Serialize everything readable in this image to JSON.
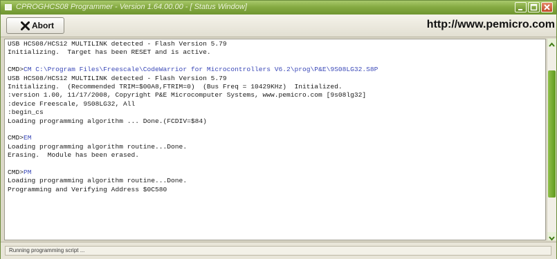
{
  "window": {
    "title": "CPROGHCS08 Programmer - Version 1.64.00.00 - [ Status Window]"
  },
  "toolbar": {
    "abort_label": "Abort",
    "website": "http://www.pemicro.com"
  },
  "console": {
    "lines": [
      {
        "text": "USB HCS08/HCS12 MULTILINK detected - Flash Version 5.79"
      },
      {
        "text": "Initializing.  Target has been RESET and is active."
      },
      {
        "text": ""
      },
      {
        "prompt": "CMD>",
        "text": "CM C:\\Program Files\\Freescale\\CodeWarrior for Microcontrollers V6.2\\prog\\P&E\\9S08LG32.S8P"
      },
      {
        "text": "USB HCS08/HCS12 MULTILINK detected - Flash Version 5.79"
      },
      {
        "text": "Initializing.  (Recommended TRIM=$00A8,FTRIM=0)  (Bus Freq = 10429KHz)  Initialized."
      },
      {
        "text": ":version 1.00, 11/17/2008, Copyright P&E Microcomputer Systems, www.pemicro.com [9s08lg32]"
      },
      {
        "text": ":device Freescale, 9S08LG32, All"
      },
      {
        "text": ":begin_cs"
      },
      {
        "text": "Loading programming algorithm ... Done.(FCDIV=$84)"
      },
      {
        "text": ""
      },
      {
        "prompt": "CMD>",
        "text": "EM"
      },
      {
        "text": "Loading programming algorithm routine...Done."
      },
      {
        "text": "Erasing.  Module has been erased."
      },
      {
        "text": ""
      },
      {
        "prompt": "CMD>",
        "text": "PM"
      },
      {
        "text": "Loading programming algorithm routine...Done."
      },
      {
        "text": "Programming and Verifying Address $0C580"
      },
      {
        "text": ""
      },
      {
        "text": ""
      },
      {
        "text": ""
      },
      {
        "text": ""
      },
      {
        "text": ""
      }
    ]
  },
  "scrollbar": {
    "position_fraction": 0.4
  },
  "status": {
    "text": "Running programming script ..."
  },
  "colors": {
    "title_bar": "#86ab43",
    "command_text": "#3b49b8",
    "scroll_thumb": "#6fa82a"
  }
}
